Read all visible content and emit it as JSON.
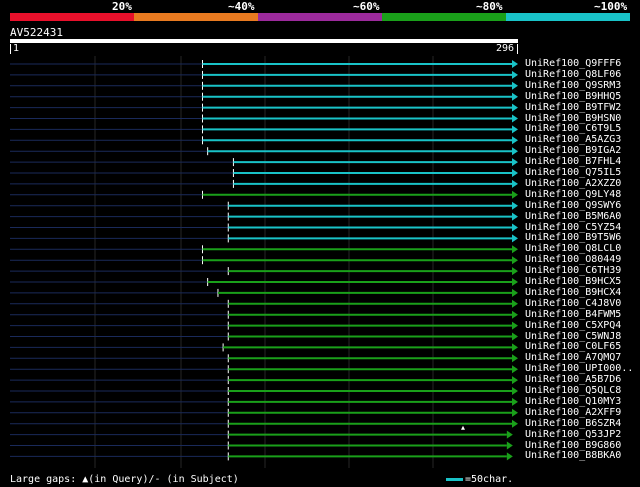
{
  "legend": {
    "labels": [
      "20%",
      "~40%",
      "~60%",
      "~80%",
      "~100%"
    ],
    "colors": [
      "#e8102b",
      "#e87a20",
      "#9c2a9c",
      "#1aa01a",
      "#19c3c8"
    ]
  },
  "query": {
    "name": "AV522431",
    "start": "1",
    "end": "296"
  },
  "hits": [
    {
      "name": "UniRef100_Q9FFF6",
      "start": 113,
      "end": 296,
      "color": "#19c3c8",
      "arrow": true
    },
    {
      "name": "UniRef100_Q8LF06",
      "start": 113,
      "end": 296,
      "color": "#19c3c8",
      "arrow": true
    },
    {
      "name": "UniRef100_Q9SRM3",
      "start": 113,
      "end": 296,
      "color": "#19c3c8",
      "arrow": true
    },
    {
      "name": "UniRef100_B9HHQ5",
      "start": 113,
      "end": 296,
      "color": "#19c3c8",
      "arrow": true
    },
    {
      "name": "UniRef100_B9TFW2",
      "start": 113,
      "end": 296,
      "color": "#19c3c8",
      "arrow": true
    },
    {
      "name": "UniRef100_B9HSN0",
      "start": 113,
      "end": 296,
      "color": "#19c3c8",
      "arrow": true
    },
    {
      "name": "UniRef100_C6T9L5",
      "start": 113,
      "end": 296,
      "color": "#19c3c8",
      "arrow": true
    },
    {
      "name": "UniRef100_A5AZG3",
      "start": 113,
      "end": 296,
      "color": "#19c3c8",
      "arrow": true
    },
    {
      "name": "UniRef100_B9IGA2",
      "start": 116,
      "end": 296,
      "color": "#19c3c8",
      "arrow": true
    },
    {
      "name": "UniRef100_B7FHL4",
      "start": 131,
      "end": 296,
      "color": "#19c3c8",
      "arrow": true
    },
    {
      "name": "UniRef100_Q75IL5",
      "start": 131,
      "end": 296,
      "color": "#19c3c8",
      "arrow": true
    },
    {
      "name": "UniRef100_A2XZZ0",
      "start": 131,
      "end": 296,
      "color": "#19c3c8",
      "arrow": true
    },
    {
      "name": "UniRef100_Q9LY48",
      "start": 113,
      "end": 296,
      "color": "#1aa01a",
      "arrow": true
    },
    {
      "name": "UniRef100_Q9SWY6",
      "start": 128,
      "end": 296,
      "color": "#19c3c8",
      "arrow": true
    },
    {
      "name": "UniRef100_B5M6A0",
      "start": 128,
      "end": 296,
      "color": "#19c3c8",
      "arrow": true
    },
    {
      "name": "UniRef100_C5YZ54",
      "start": 128,
      "end": 296,
      "color": "#19c3c8",
      "arrow": true
    },
    {
      "name": "UniRef100_B9T5W6",
      "start": 128,
      "end": 296,
      "color": "#19c3c8",
      "arrow": true
    },
    {
      "name": "UniRef100_Q8LCL0",
      "start": 113,
      "end": 296,
      "color": "#1aa01a",
      "arrow": true
    },
    {
      "name": "UniRef100_O80449",
      "start": 113,
      "end": 296,
      "color": "#1aa01a",
      "arrow": true
    },
    {
      "name": "UniRef100_C6TH39",
      "start": 128,
      "end": 296,
      "color": "#1aa01a",
      "arrow": true
    },
    {
      "name": "UniRef100_B9HCX5",
      "start": 116,
      "end": 296,
      "color": "#1aa01a",
      "arrow": true
    },
    {
      "name": "UniRef100_B9HCX4",
      "start": 122,
      "end": 296,
      "color": "#1aa01a",
      "arrow": true
    },
    {
      "name": "UniRef100_C4J8V0",
      "start": 128,
      "end": 296,
      "color": "#1aa01a",
      "arrow": true
    },
    {
      "name": "UniRef100_B4FWM5",
      "start": 128,
      "end": 296,
      "color": "#1aa01a",
      "arrow": true
    },
    {
      "name": "UniRef100_C5XPQ4",
      "start": 128,
      "end": 296,
      "color": "#1aa01a",
      "arrow": true
    },
    {
      "name": "UniRef100_C5WNJ8",
      "start": 128,
      "end": 296,
      "color": "#1aa01a",
      "arrow": true
    },
    {
      "name": "UniRef100_C0LF65",
      "start": 125,
      "end": 296,
      "color": "#1aa01a",
      "arrow": true
    },
    {
      "name": "UniRef100_A7QMQ7",
      "start": 128,
      "end": 296,
      "color": "#1aa01a",
      "arrow": true
    },
    {
      "name": "UniRef100_UPI000..",
      "start": 128,
      "end": 296,
      "color": "#1aa01a",
      "arrow": true
    },
    {
      "name": "UniRef100_A5B7D6",
      "start": 128,
      "end": 296,
      "color": "#1aa01a",
      "arrow": true
    },
    {
      "name": "UniRef100_Q5QLC8",
      "start": 128,
      "end": 296,
      "color": "#1aa01a",
      "arrow": true
    },
    {
      "name": "UniRef100_Q10MY3",
      "start": 128,
      "end": 296,
      "color": "#1aa01a",
      "arrow": true
    },
    {
      "name": "UniRef100_A2XFF9",
      "start": 128,
      "end": 296,
      "color": "#1aa01a",
      "arrow": true
    },
    {
      "name": "UniRef100_B6SZR4",
      "start": 128,
      "end": 296,
      "color": "#1aa01a",
      "arrow": true,
      "gap_marker": true
    },
    {
      "name": "UniRef100_Q53JP2",
      "start": 128,
      "end": 293,
      "color": "#1aa01a",
      "arrow": true
    },
    {
      "name": "UniRef100_B9G860",
      "start": 128,
      "end": 293,
      "color": "#1aa01a",
      "arrow": true
    },
    {
      "name": "UniRef100_B8BKA0",
      "start": 128,
      "end": 293,
      "color": "#1aa01a",
      "arrow": true
    }
  ],
  "footer": {
    "gaps_text": "Large gaps: ▲(in Query)/- (in Subject)",
    "scale_text": "=50char."
  }
}
